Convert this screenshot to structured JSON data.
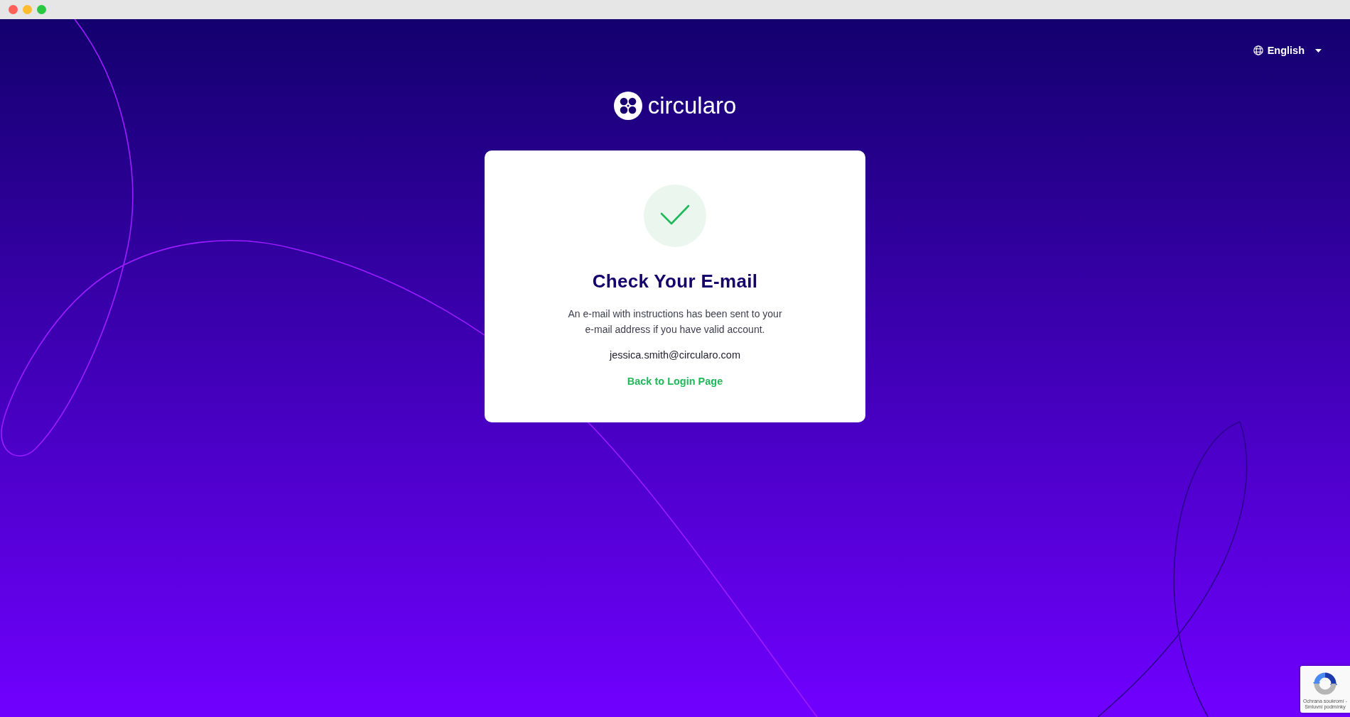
{
  "language_selector": {
    "label": "English"
  },
  "logo": {
    "wordmark": "circularo"
  },
  "card": {
    "title": "Check Your E-mail",
    "message": "An e-mail with instructions has been sent to your e-mail address if you have valid account.",
    "email": "jessica.smith@circularo.com",
    "link": "Back to Login Page"
  },
  "recaptcha_badge": {
    "text": "Ochrana soukromí - Smluvní podmínky"
  }
}
